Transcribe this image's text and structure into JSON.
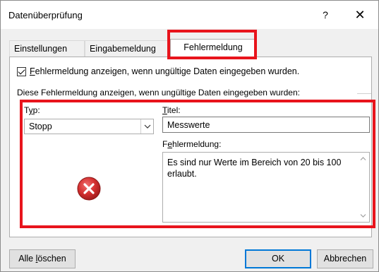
{
  "window": {
    "title": "Datenüberprüfung",
    "help_label": "?",
    "close_label": "✕"
  },
  "tabs": [
    {
      "label": "Einstellungen"
    },
    {
      "label": "Eingabemeldung"
    },
    {
      "label": "Fehlermeldung",
      "active": true
    }
  ],
  "panel": {
    "show_error_checkbox": {
      "checked": true,
      "label_first": "F",
      "label_rest": "ehlermeldung anzeigen, wenn ungültige Daten eingegeben wurden."
    },
    "group_label": "Diese Fehlermeldung anzeigen, wenn ungültige Daten eingegeben wurden:",
    "type": {
      "label_first": "T",
      "label_mid": "y",
      "label_rest": "p:",
      "selected": "Stopp"
    },
    "title_field": {
      "label_first": "T",
      "label_rest": "itel:",
      "value": "Messwerte"
    },
    "message_field": {
      "label_a": "F",
      "label_b": "e",
      "label_c": "hlermeldung:",
      "value": "Es sind nur Werte im Bereich von 20 bis 100 erlaubt."
    },
    "icon": "error-stop-icon"
  },
  "buttons": {
    "clear_all_a": "Alle ",
    "clear_all_b": "l",
    "clear_all_c": "öschen",
    "ok": "OK",
    "cancel": "Abbrechen"
  },
  "colors": {
    "highlight": "#e8141c",
    "error_icon": "#c62828",
    "accent": "#0078d7"
  }
}
